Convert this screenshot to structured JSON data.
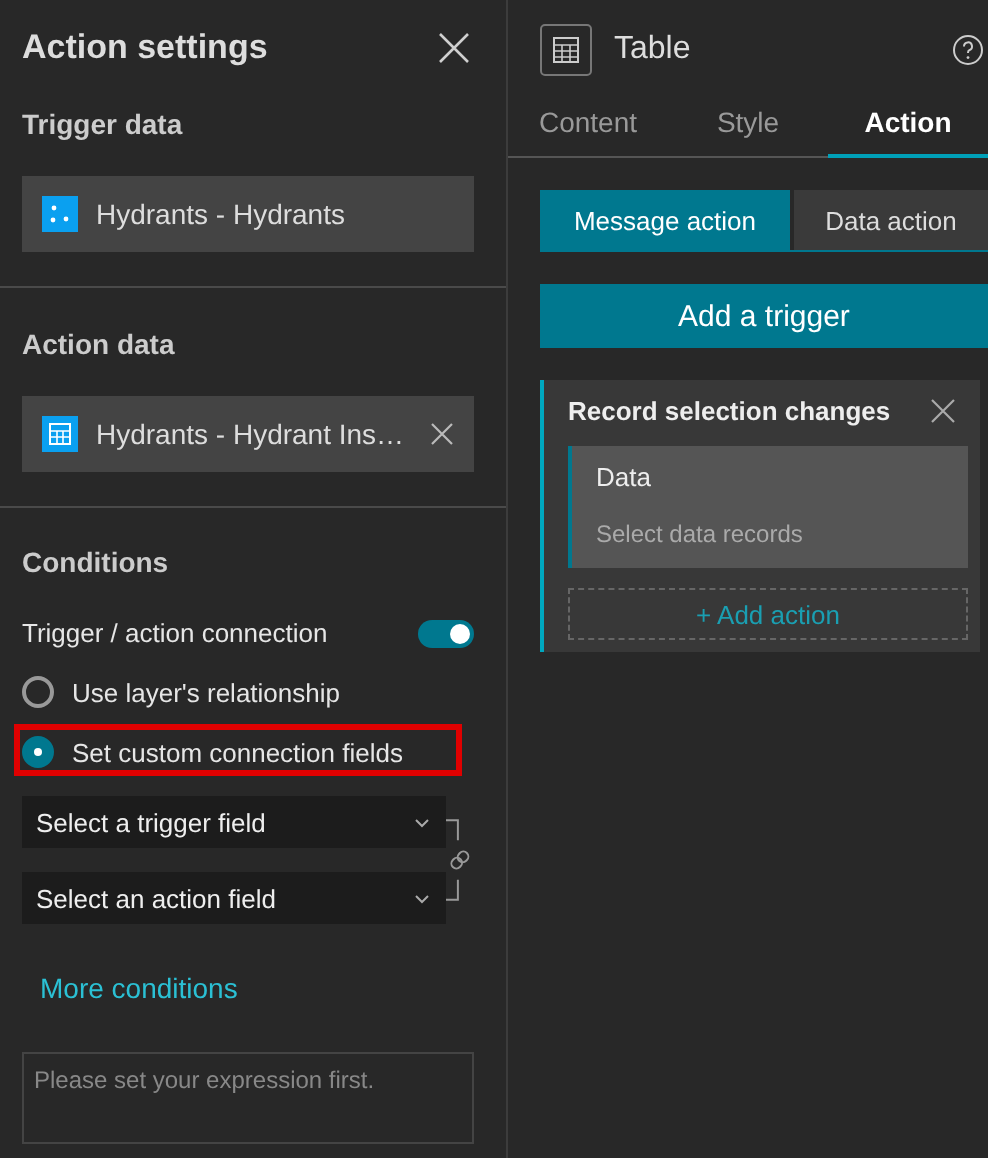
{
  "left_panel": {
    "title": "Action settings",
    "trigger_data": {
      "heading": "Trigger data",
      "source": {
        "label": "Hydrants - Hydrants",
        "kind": "layer",
        "removable": false
      }
    },
    "action_data": {
      "heading": "Action data",
      "source": {
        "label": "Hydrants - Hydrant Ins…",
        "kind": "table",
        "removable": true
      }
    },
    "conditions": {
      "heading": "Conditions",
      "connection": {
        "label": "Trigger / action connection",
        "on": true
      },
      "options": [
        {
          "label": "Use layer's relationship",
          "selected": false,
          "highlighted": false
        },
        {
          "label": "Set custom connection fields",
          "selected": true,
          "highlighted": true
        }
      ],
      "fields": [
        {
          "placeholder": "Select a trigger field"
        },
        {
          "placeholder": "Select an action field"
        }
      ],
      "more_link": "More conditions",
      "expression": {
        "placeholder": "Please set your expression first."
      }
    }
  },
  "right_panel": {
    "widget_title": "Table",
    "tabs": [
      {
        "label": "Content",
        "selected": false
      },
      {
        "label": "Style",
        "selected": false
      },
      {
        "label": "Action",
        "selected": true
      }
    ],
    "segments": [
      {
        "label": "Message action",
        "selected": true
      },
      {
        "label": "Data action",
        "selected": false
      }
    ],
    "add_trigger": "Add a trigger",
    "trigger_card": {
      "title": "Record selection changes",
      "data": {
        "heading": "Data",
        "hint": "Select data records"
      },
      "add_action": "+ Add action"
    }
  }
}
